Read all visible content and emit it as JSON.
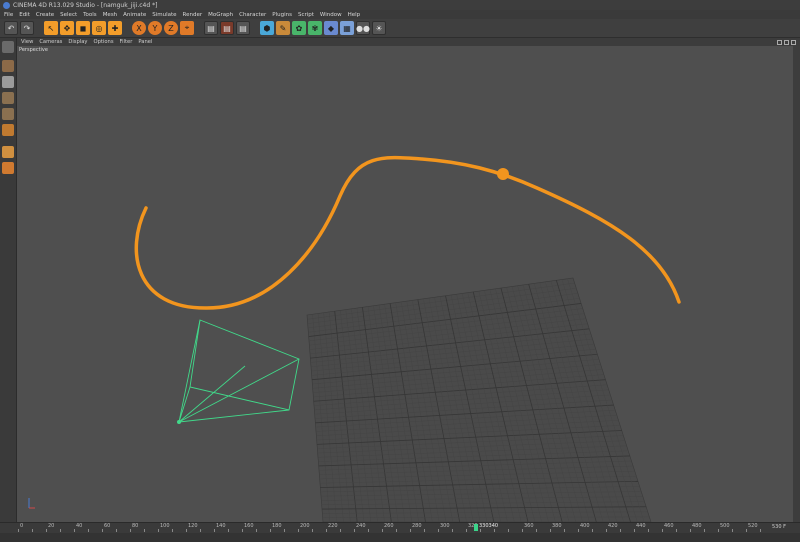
{
  "window": {
    "title": "CINEMA 4D R13.029 Studio - [namguk_jiji.c4d *]"
  },
  "menu": [
    "File",
    "Edit",
    "Create",
    "Select",
    "Tools",
    "Mesh",
    "Animate",
    "Simulate",
    "Render",
    "MoGraph",
    "Character",
    "Plugins",
    "Script",
    "Window",
    "Help"
  ],
  "view_menu": [
    "View",
    "Cameras",
    "Display",
    "Options",
    "Filter",
    "Panel"
  ],
  "viewport": {
    "label": "Perspective"
  },
  "colors": {
    "spline": "#f2951e",
    "camera": "#41d98a",
    "grid": "#3d3d3d",
    "viewport_bg": "#4f4f4f"
  },
  "toolbar_icons": [
    "undo-icon",
    "redo-icon",
    "live-select-icon",
    "move-icon",
    "scale-icon",
    "rotate-icon",
    "recent-tool-icon",
    "x-axis-icon",
    "y-axis-icon",
    "z-axis-icon",
    "world-coord-icon",
    "render-view-icon",
    "render-picture-viewer-icon",
    "render-settings-icon",
    "cube-icon",
    "spline-pen-icon",
    "nurbs-icon",
    "array-icon",
    "deformer-icon",
    "scene-icon",
    "camera-icon",
    "light-icon"
  ],
  "timeline": {
    "ticks": [
      "0",
      "10",
      "20",
      "30",
      "40",
      "50",
      "60",
      "70",
      "80",
      "90",
      "100",
      "110",
      "120",
      "130",
      "140",
      "150",
      "160",
      "170",
      "180",
      "190",
      "200",
      "210",
      "220",
      "230",
      "240",
      "250",
      "260",
      "270",
      "280",
      "290",
      "300",
      "310",
      "320",
      "330",
      "340",
      "350",
      "360",
      "370",
      "380",
      "390",
      "400",
      "410",
      "420",
      "430",
      "440",
      "450",
      "460",
      "470",
      "480",
      "490",
      "500",
      "510",
      "520",
      "530"
    ],
    "current_frame": "340",
    "current_frame_label": "330340",
    "end_frame": "530 F"
  }
}
